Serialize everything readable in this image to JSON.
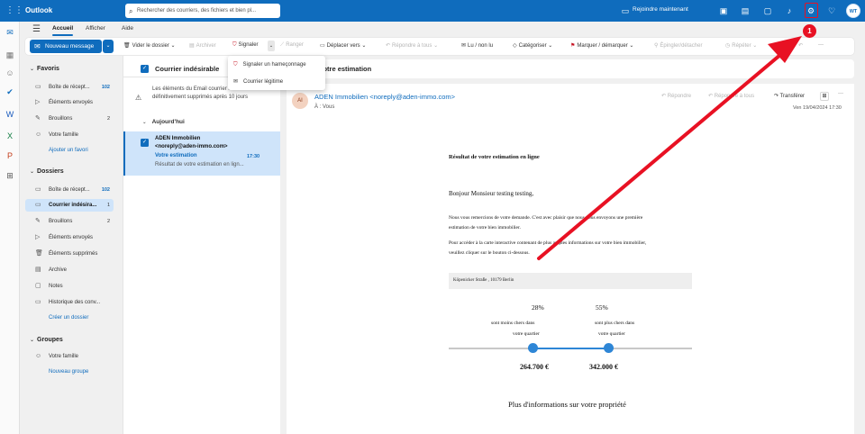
{
  "app": {
    "name": "Outlook",
    "user_initials": "WT"
  },
  "search": {
    "placeholder": "Rechercher des courriers, des fichiers et bien pl..."
  },
  "topbar": {
    "join_label": "Rejoindre maintenant"
  },
  "tabs": [
    {
      "label": "Accueil"
    },
    {
      "label": "Afficher"
    },
    {
      "label": "Aide"
    }
  ],
  "ribbon": {
    "new_message": "Nouveau message",
    "empty_folder": "Vider le dossier",
    "archive": "Archiver",
    "report": "Signaler",
    "sweep": "Ranger",
    "move_to": "Déplacer vers",
    "reply_all": "Répondre à tous",
    "read_unread": "Lu / non lu",
    "categorize": "Catégoriser",
    "flag": "Marquer / démarquer",
    "pin": "Épingler/détacher",
    "snooze": "Répéter",
    "more": "···"
  },
  "report_menu": {
    "phishing": "Signaler un hameçonnage",
    "legit": "Courrier légitime"
  },
  "sidebar": {
    "favorites_title": "Favoris",
    "favorites": [
      {
        "label": "Boîte de récept...",
        "count": "102"
      },
      {
        "label": "Éléments envoyés",
        "count": ""
      },
      {
        "label": "Brouillons",
        "count": "2"
      },
      {
        "label": "Votre famille",
        "count": ""
      }
    ],
    "add_favorite": "Ajouter un favori",
    "folders_title": "Dossiers",
    "folders": [
      {
        "label": "Boîte de récept...",
        "count": "102"
      },
      {
        "label": "Courrier indésira...",
        "count": "1"
      },
      {
        "label": "Brouillons",
        "count": "2"
      },
      {
        "label": "Éléments envoyés",
        "count": ""
      },
      {
        "label": "Éléments supprimés",
        "count": ""
      },
      {
        "label": "Archive",
        "count": ""
      },
      {
        "label": "Notes",
        "count": ""
      },
      {
        "label": "Historique des conv...",
        "count": ""
      }
    ],
    "create_folder": "Créer un dossier",
    "groups_title": "Groupes",
    "groups": [
      {
        "label": "Votre famille"
      }
    ],
    "new_group": "Nouveau groupe"
  },
  "list": {
    "title": "Courrier indésirable",
    "notice": "Les éléments du Email courrier indésirable seront définitivement supprimés après 10 jours",
    "group_today": "Aujourd'hui",
    "item": {
      "sender": "ADEN Immobilien",
      "sender_email": "<noreply@aden-immo.com>",
      "subject": "Votre estimation",
      "time": "17:30",
      "preview": "Résultat de votre estimation en lign..."
    }
  },
  "reading": {
    "subject": "Votre estimation",
    "avatar": "AI",
    "from": "ADEN Immobilien <noreply@aden-immo.com>",
    "to_prefix": "À :",
    "to": "Vous",
    "reply": "Répondre",
    "reply_all": "Répondre à tous",
    "forward": "Transférer",
    "date": "Ven 19/04/2024 17:30",
    "body": {
      "heading": "Résultat de votre estimation en ligne",
      "greeting": "Bonjour Monsieur testing testing,",
      "p1_l1": "Nous vous remercions de votre demande. C'est avec plaisir que nous vous envoyons une première",
      "p1_l2": "estimation de votre bien immobilier.",
      "p2_l1": "Pour accéder à la carte interactive contenant de plus amples informations sur votre bien immobilier,",
      "p2_l2": "veuillez cliquer sur le bouton ci-dessous.",
      "address": "Köpenicker Straße , 10179 Berlin",
      "pct_low": "28%",
      "pct_high": "55%",
      "low_l1": "sont moins chers dans",
      "low_l2": "votre quartier",
      "high_l1": "sont plus chers dans",
      "high_l2": "votre quartier",
      "price_low": "264.700 €",
      "price_high": "342.000 €",
      "more_info": "Plus d'informations sur votre propriété"
    }
  },
  "annotation": {
    "badge": "1",
    "color": "#e81123"
  },
  "colors": {
    "brand": "#0f6cbd",
    "selected": "#cfe4fa",
    "annotation": "#e81123"
  }
}
